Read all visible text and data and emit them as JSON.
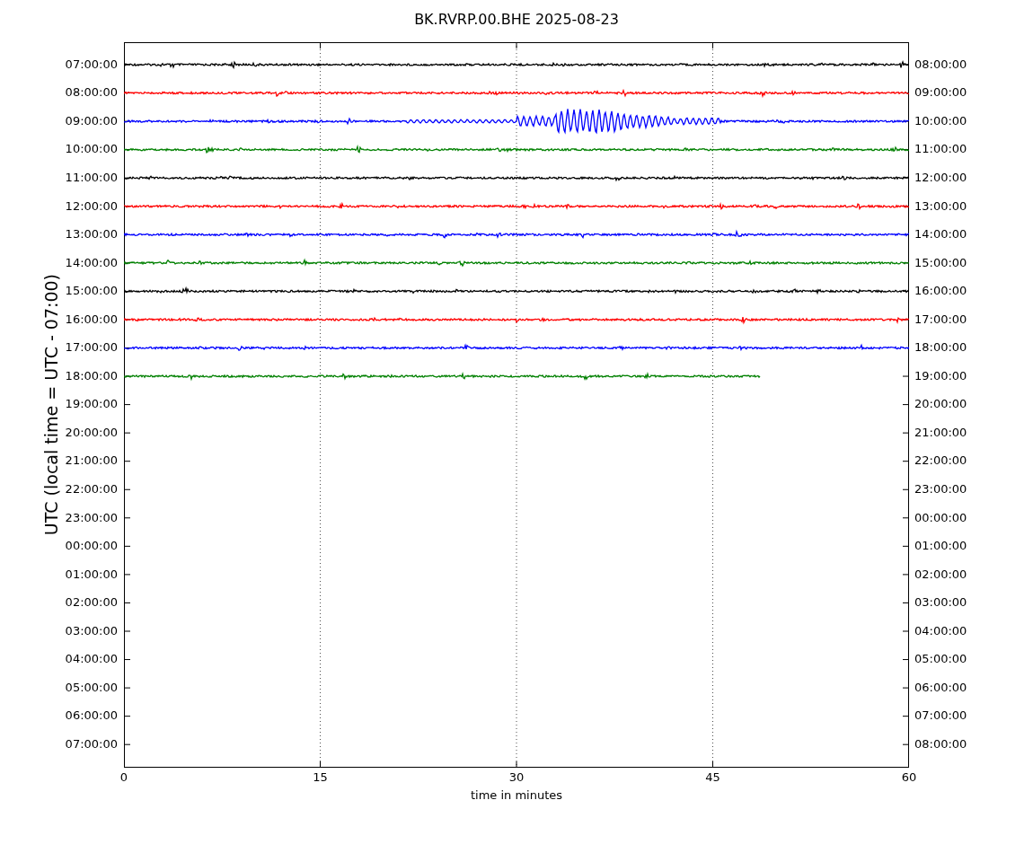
{
  "title": "BK.RVRP.00.BHE 2025-08-23",
  "ylabel": "UTC (local time = UTC - 07:00)",
  "xlabel": "time in minutes",
  "xticks": [
    "0",
    "15",
    "30",
    "45",
    "60"
  ],
  "left_labels": [
    "07:00:00",
    "08:00:00",
    "09:00:00",
    "10:00:00",
    "11:00:00",
    "12:00:00",
    "13:00:00",
    "14:00:00",
    "15:00:00",
    "16:00:00",
    "17:00:00",
    "18:00:00",
    "19:00:00",
    "20:00:00",
    "21:00:00",
    "22:00:00",
    "23:00:00",
    "00:00:00",
    "01:00:00",
    "02:00:00",
    "03:00:00",
    "04:00:00",
    "05:00:00",
    "06:00:00",
    "07:00:00"
  ],
  "right_labels": [
    "08:00:00",
    "09:00:00",
    "10:00:00",
    "11:00:00",
    "12:00:00",
    "13:00:00",
    "14:00:00",
    "15:00:00",
    "16:00:00",
    "17:00:00",
    "18:00:00",
    "19:00:00",
    "20:00:00",
    "21:00:00",
    "22:00:00",
    "23:00:00",
    "00:00:00",
    "01:00:00",
    "02:00:00",
    "03:00:00",
    "04:00:00",
    "05:00:00",
    "06:00:00",
    "07:00:00",
    "08:00:00"
  ],
  "traces": [
    {
      "kind": "noise",
      "color": "#000000",
      "level": 1
    },
    {
      "kind": "noise",
      "color": "#ff0000",
      "level": 1
    },
    {
      "kind": "event",
      "color": "#0000ff",
      "level": 1
    },
    {
      "kind": "noise",
      "color": "#008000",
      "level": 1
    },
    {
      "kind": "noise",
      "color": "#000000",
      "level": 1
    },
    {
      "kind": "noise",
      "color": "#ff0000",
      "level": 1
    },
    {
      "kind": "noise",
      "color": "#0000ff",
      "level": 1
    },
    {
      "kind": "noise",
      "color": "#008000",
      "level": 1
    },
    {
      "kind": "noise",
      "color": "#000000",
      "level": 1
    },
    {
      "kind": "noise",
      "color": "#ff0000",
      "level": 1
    },
    {
      "kind": "noise",
      "color": "#0000ff",
      "level": 1
    },
    {
      "kind": "noise",
      "color": "#008000",
      "level": 0.81
    }
  ]
}
